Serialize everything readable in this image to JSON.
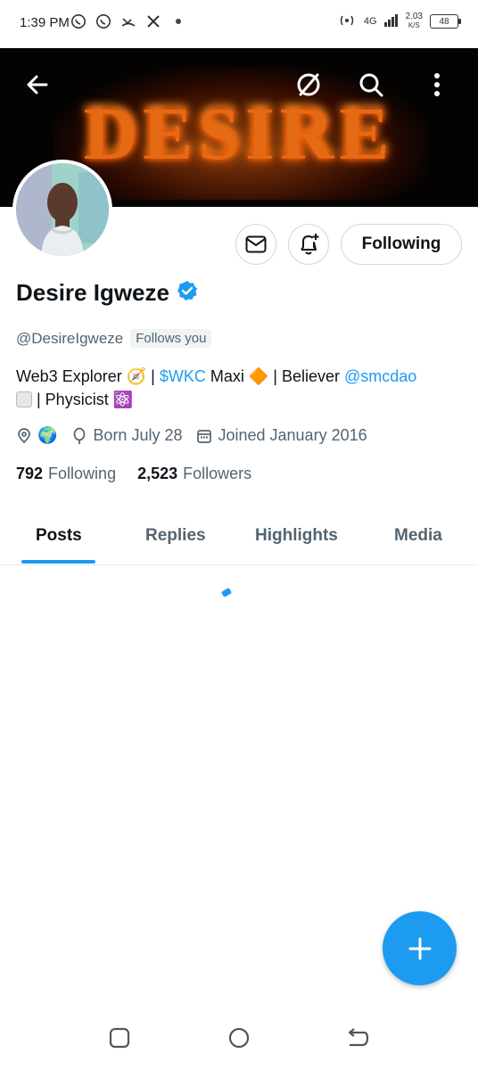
{
  "status_bar": {
    "time": "1:39 PM",
    "network": "4G",
    "speed_value": "2.03",
    "speed_unit": "K/S",
    "battery": "48"
  },
  "banner": {
    "text": "DESIRE"
  },
  "profile": {
    "name": "Desire Igweze",
    "handle": "@DesireIgweze",
    "follows_you": "Follows you",
    "bio": {
      "part1": "Web3 Explorer 🧭 | ",
      "cashtag": "$WKC",
      "part2": " Maxi 🔶 | Believer ",
      "mention": "@smcdao",
      "part3": " | Physicist ⚛️"
    },
    "location_emoji": "🌍",
    "born": "Born July 28",
    "joined": "Joined January 2016",
    "following_count": "792",
    "following_label": "Following",
    "followers_count": "2,523",
    "followers_label": "Followers"
  },
  "actions": {
    "follow_label": "Following"
  },
  "tabs": [
    {
      "label": "Posts"
    },
    {
      "label": "Replies"
    },
    {
      "label": "Highlights"
    },
    {
      "label": "Media"
    }
  ],
  "colors": {
    "accent": "#1d9bf0",
    "text_secondary": "#536471"
  }
}
